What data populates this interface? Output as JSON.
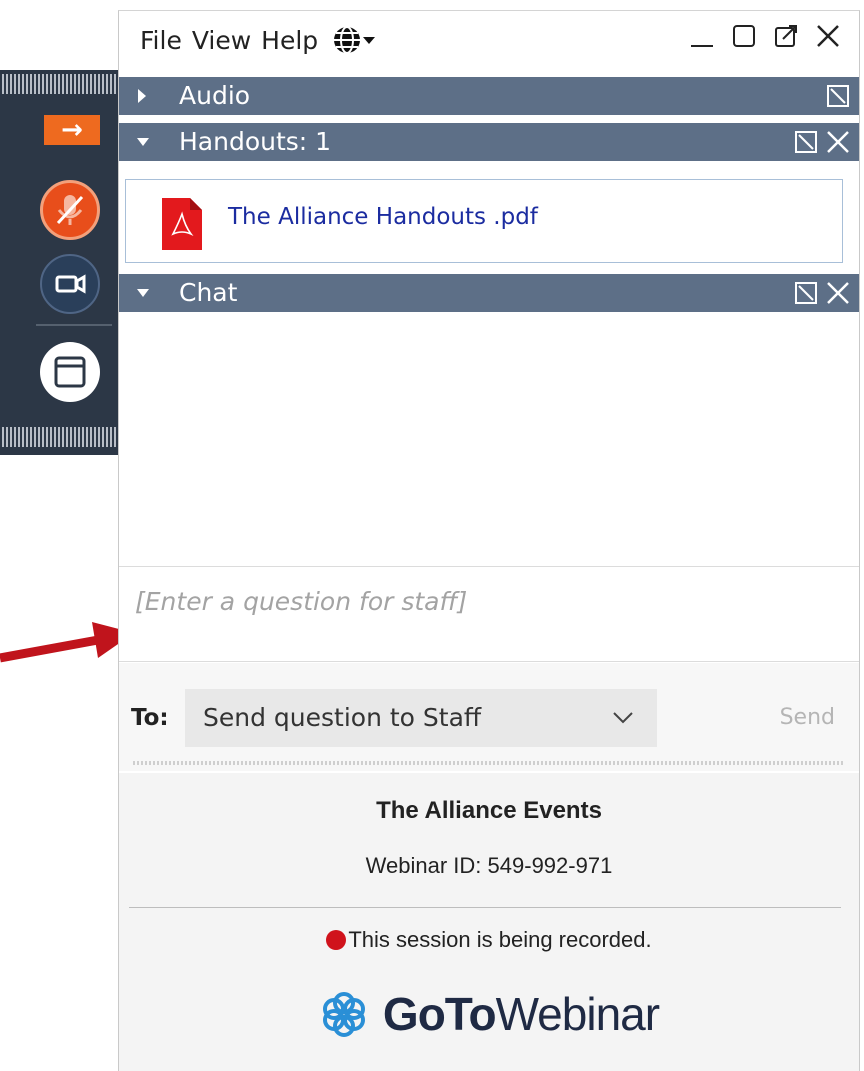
{
  "menu": {
    "file": "File",
    "view": "View",
    "help": "Help"
  },
  "sections": {
    "audio": "Audio",
    "handouts": "Handouts: 1",
    "chat": "Chat"
  },
  "handouts": [
    {
      "name": "The Alliance Handouts .pdf",
      "icon": "pdf-icon"
    }
  ],
  "question": {
    "placeholder": "[Enter a question for staff]"
  },
  "to": {
    "label": "To:",
    "selected": "Send question to Staff",
    "send": "Send"
  },
  "footer": {
    "event_name": "The Alliance Events",
    "webinar_id": "Webinar ID: 549-992-971",
    "recording": "This session is being recorded.",
    "brand_bold": "GoTo",
    "brand_light": "Webinar"
  },
  "colors": {
    "section_header": "#5d6f87",
    "dock": "#2c3746",
    "accent_orange": "#ee6a1f",
    "mic_red": "#e84e1b",
    "link": "#1b2ca0",
    "recording_dot": "#d0121b",
    "annotation_arrow": "#c0141c"
  }
}
